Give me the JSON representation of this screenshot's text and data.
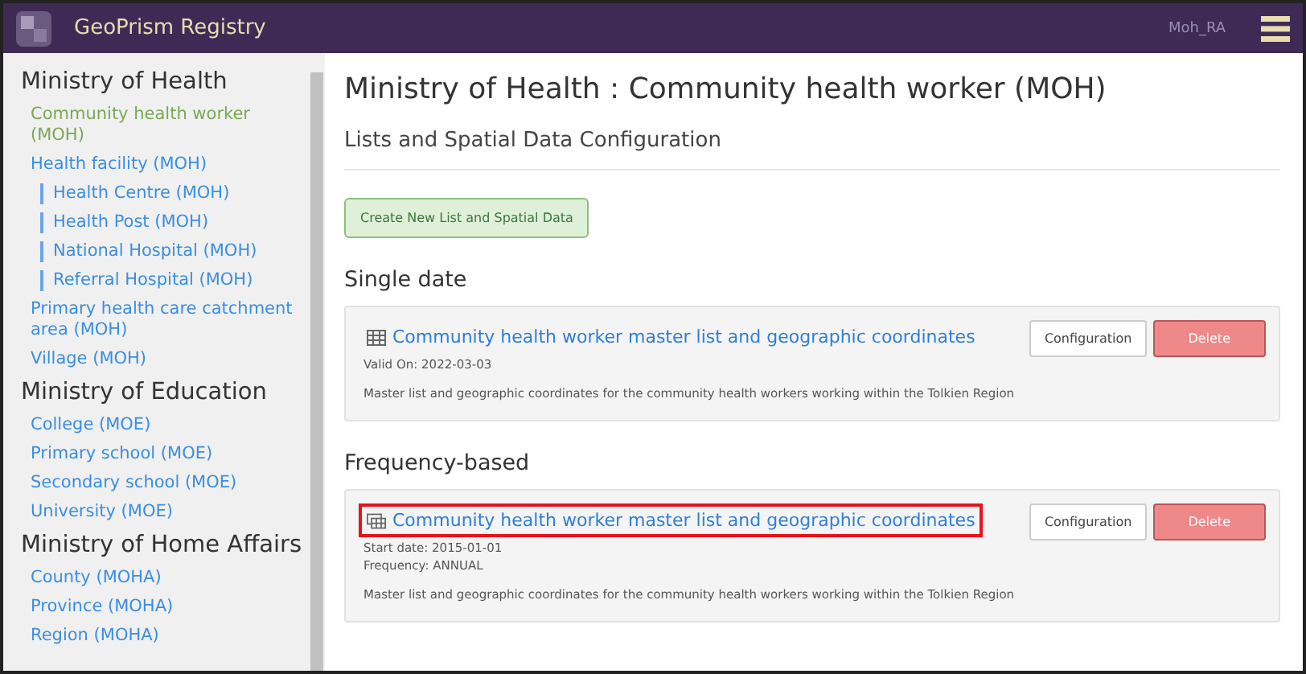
{
  "header": {
    "title": "GeoPrism Registry",
    "user": "Moh_RA"
  },
  "sidebar": {
    "groups": [
      {
        "title": "Ministry of Health",
        "items": [
          {
            "label": "Community health worker (MOH)",
            "selected": true
          },
          {
            "label": "Health facility (MOH)",
            "selected": false,
            "children": [
              {
                "label": "Health Centre (MOH)",
                "selected": false
              },
              {
                "label": "Health Post (MOH)",
                "selected": false
              },
              {
                "label": "National Hospital (MOH)",
                "selected": false
              },
              {
                "label": "Referral Hospital (MOH)",
                "selected": false
              }
            ]
          },
          {
            "label": "Primary health care catchment area (MOH)",
            "selected": false
          },
          {
            "label": "Village (MOH)",
            "selected": false
          }
        ]
      },
      {
        "title": "Ministry of Education",
        "items": [
          {
            "label": "College (MOE)",
            "selected": false
          },
          {
            "label": "Primary school (MOE)",
            "selected": false
          },
          {
            "label": "Secondary school (MOE)",
            "selected": false
          },
          {
            "label": "University (MOE)",
            "selected": false
          }
        ]
      },
      {
        "title": "Ministry of Home Affairs",
        "items": [
          {
            "label": "County (MOHA)",
            "selected": false
          },
          {
            "label": "Province (MOHA)",
            "selected": false
          },
          {
            "label": "Region (MOHA)",
            "selected": false
          }
        ]
      }
    ]
  },
  "main": {
    "title": "Ministry of Health : Community health worker (MOH)",
    "subtitle": "Lists and Spatial Data Configuration",
    "create_button": "Create New List and Spatial Data",
    "sections": [
      {
        "title": "Single date",
        "lists": [
          {
            "kind": "single",
            "title": "Community health worker master list and geographic coordinates",
            "highlighted": false,
            "details": [
              "Valid On: 2022-03-03"
            ],
            "description": "Master list and geographic coordinates for the community health workers working within the Tolkien Region",
            "configure_button": "Configuration",
            "delete_button": "Delete"
          }
        ]
      },
      {
        "title": "Frequency-based",
        "lists": [
          {
            "kind": "frequency",
            "title": "Community health worker master list and geographic coordinates",
            "highlighted": true,
            "details": [
              "Start date: 2015-01-01",
              "Frequency: ANNUAL"
            ],
            "description": "Master list and geographic coordinates for the community health workers working within the Tolkien Region",
            "configure_button": "Configuration",
            "delete_button": "Delete"
          }
        ]
      }
    ]
  }
}
